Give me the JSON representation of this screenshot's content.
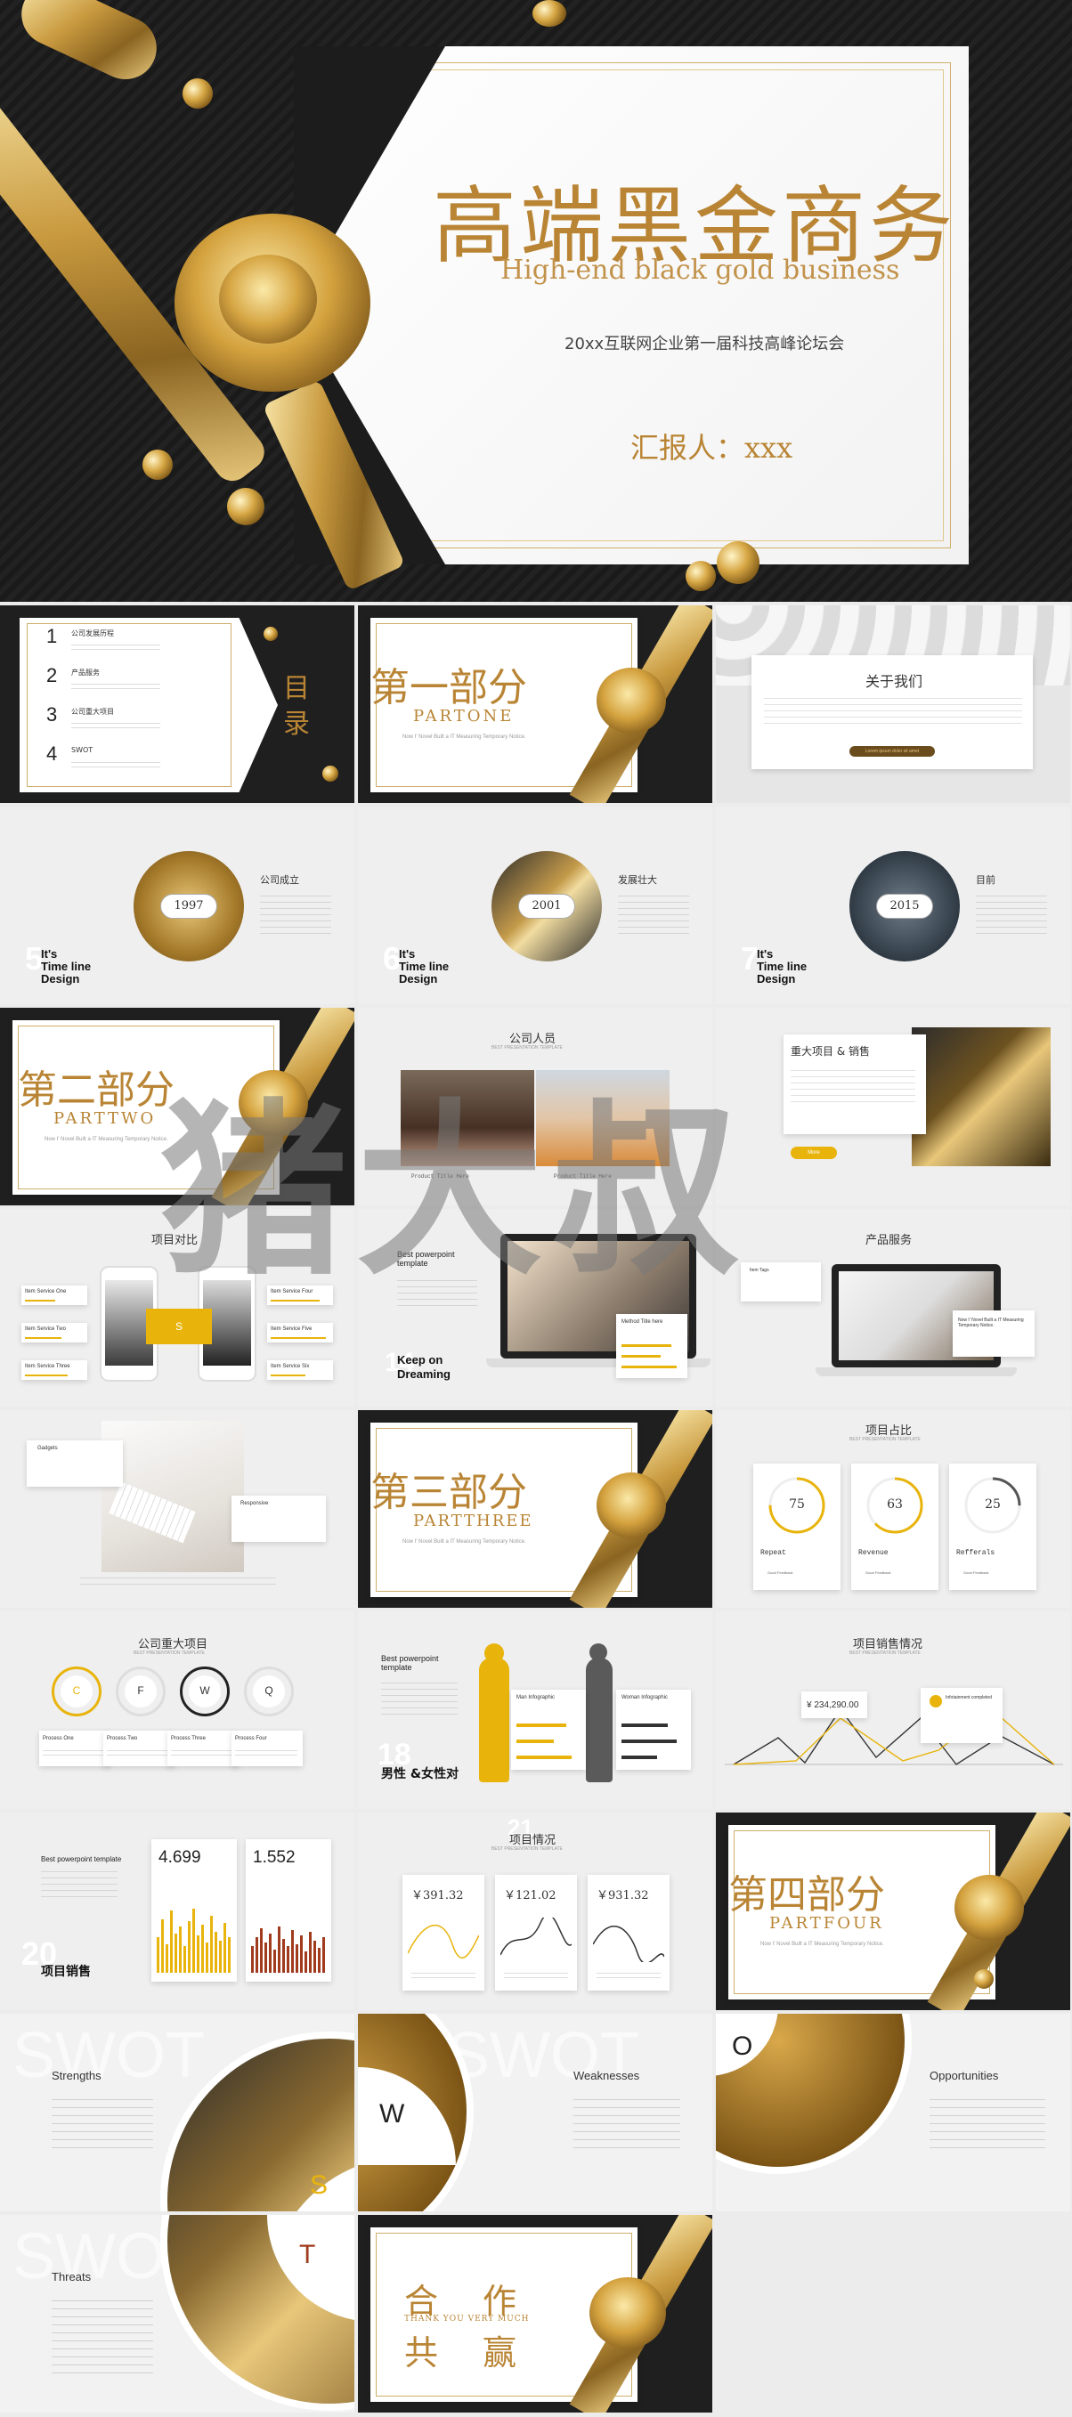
{
  "hero": {
    "title": "高端黑金商务",
    "subtitle": "High-end black gold business",
    "forum": "20xx互联网企业第一届科技高峰论坛会",
    "reporter": "汇报人：xxx"
  },
  "s1": {
    "items": [
      {
        "num": "1",
        "label": "公司发展历程"
      },
      {
        "num": "2",
        "label": "产品服务"
      },
      {
        "num": "3",
        "label": "公司重大项目"
      },
      {
        "num": "4",
        "label": "SWOT"
      }
    ],
    "title_a": "目",
    "title_b": "录"
  },
  "s2": {
    "title": "第一部分",
    "en": "PARTONE",
    "note": "Now I' Novel Built a IT Measuring Temporary Notice."
  },
  "s3": {
    "title": "关于我们",
    "button": "Lorem ipsum dolor sit amet"
  },
  "timeline": [
    {
      "year": "1997",
      "title": "公司成立",
      "num": "5",
      "label1": "It's",
      "label2": "Time line",
      "label3": "Design"
    },
    {
      "year": "2001",
      "title": "发展壮大",
      "num": "6",
      "label1": "It's",
      "label2": "Time line",
      "label3": "Design"
    },
    {
      "year": "2015",
      "title": "目前",
      "num": "7",
      "label1": "It's",
      "label2": "Time line",
      "label3": "Design"
    }
  ],
  "s8": {
    "title": "第二部分",
    "en": "PARTTWO",
    "note": "Now I' Novel Built a IT Measuring Temporary Notice."
  },
  "s9": {
    "title": "公司人员",
    "sub": "BEST PRESENTATION TEMPLATE",
    "cap1": "Product Title Here",
    "cap2": "Product Title Here"
  },
  "s10": {
    "title": "重大项目 & 销售",
    "btn": "More"
  },
  "s11": {
    "title": "项目对比",
    "labels": [
      "Item Service One",
      "Item Service Two",
      "Item Service Three",
      "Item Service Four",
      "Item Service Five",
      "Item Service Six"
    ],
    "mark": "S"
  },
  "s12": {
    "heading": "Best powerpoint template",
    "footer1": "Keep on",
    "footer2": "Dreaming",
    "num": "14",
    "card": "Method Title here"
  },
  "s13": {
    "title": "产品服务",
    "card1": "Item Tags",
    "card2": "Now I' Novel Built a IT Measuring Temporary Notice."
  },
  "s14": {
    "card1": "Gadgets",
    "card2": "Responsive"
  },
  "s15": {
    "title": "第三部分",
    "en": "PARTTHREE",
    "note": "Now I' Novel Built a IT Measuring Temporary Notice."
  },
  "s16": {
    "title": "项目占比",
    "sub": "BEST PRESENTATION TEMPLATE",
    "items": [
      {
        "pct": "75",
        "label": "Repeat",
        "fill": 0.75,
        "foot": "Good Feedback"
      },
      {
        "pct": "63",
        "label": "Revenue",
        "fill": 0.63,
        "foot": "Good Feedback"
      },
      {
        "pct": "25",
        "label": "Refferals",
        "fill": 0.25,
        "foot": "Good Feedback"
      }
    ]
  },
  "s17": {
    "title": "公司重大项目",
    "sub": "BEST PRESENTATION TEMPLATE",
    "circles": [
      "C",
      "F",
      "W",
      "Q"
    ],
    "steps": [
      "Process One",
      "Process Two",
      "Process Three",
      "Process Four"
    ]
  },
  "s18": {
    "heading1": "Best powerpoint",
    "heading2": "template",
    "num": "18",
    "footer": "男性 &女性对",
    "card1": "Man Infographic",
    "card2": "Woman Infographic"
  },
  "s19": {
    "title": "项目销售情况",
    "sub": "BEST PRESENTATION TEMPLATE",
    "value": "¥ 234,290.00",
    "card": "Infotainment completed"
  },
  "s20": {
    "heading": "Best powerpoint template",
    "num": "20",
    "footer": "项目销售",
    "v1": "4.699",
    "v2": "1.552"
  },
  "s21": {
    "title": "项目情况",
    "num": "21",
    "sub": "BEST PRESENTATION TEMPLATE",
    "values": [
      "￥391.32",
      "￥121.02",
      "￥931.32"
    ]
  },
  "s22": {
    "title": "第四部分",
    "en": "PARTFOUR",
    "note": "Now I' Novel Built a IT Measuring Temporary Notice."
  },
  "swot": {
    "strengths": "Strengths",
    "weaknesses": "Weaknesses",
    "opportunities": "Opportunities",
    "threats": "Threats",
    "s": "S",
    "w": "W",
    "o": "O",
    "t": "T",
    "wm": "SWOT"
  },
  "end": {
    "a": "合",
    "b": "作",
    "c": "共",
    "d": "赢",
    "en": "THANK YOU VERY MUCH"
  },
  "watermark": "猪大叔",
  "colors": {
    "gold": "#b98535",
    "yellow": "#e8b40c",
    "dark": "#1f1f1f"
  }
}
